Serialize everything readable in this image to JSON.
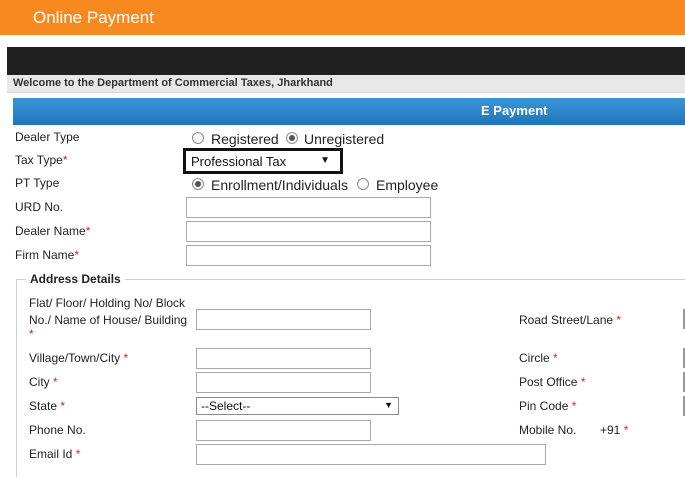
{
  "header": {
    "title": "Online Payment"
  },
  "welcome_text": "Welcome to the Department of Commercial Taxes, Jharkhand",
  "section_title": "E Payment",
  "form": {
    "dealer_type": {
      "label": "Dealer Type",
      "options": [
        "Registered",
        "Unregistered"
      ],
      "selected": "Unregistered"
    },
    "tax_type": {
      "label": "Tax Type",
      "value": "Professional Tax"
    },
    "pt_type": {
      "label": "PT Type",
      "options": [
        "Enrollment/Individuals",
        "Employee"
      ],
      "selected": "Enrollment/Individuals"
    },
    "urd_no": {
      "label": "URD No.",
      "value": ""
    },
    "dealer_name": {
      "label": "Dealer Name",
      "value": ""
    },
    "firm_name": {
      "label": "Firm Name",
      "value": ""
    }
  },
  "address": {
    "legend": "Address Details",
    "flat_label_line1": "Flat/ Floor/ Holding No/ Block",
    "flat_label_line2": "No./ Name of House/ Building",
    "road_label": "Road Street/Lane",
    "village_label": "Village/Town/City",
    "circle_label": "Circle",
    "city_label": "City",
    "post_office_label": "Post Office",
    "state_label": "State",
    "state_value": "--Select--",
    "pin_label": "Pin Code",
    "phone_label": "Phone No.",
    "mobile_label": "Mobile No.",
    "mobile_prefix": "+91",
    "email_label": "Email Id"
  },
  "colors": {
    "header": "#f7891f",
    "section": "#1f74bb",
    "required": "#d9221c"
  }
}
